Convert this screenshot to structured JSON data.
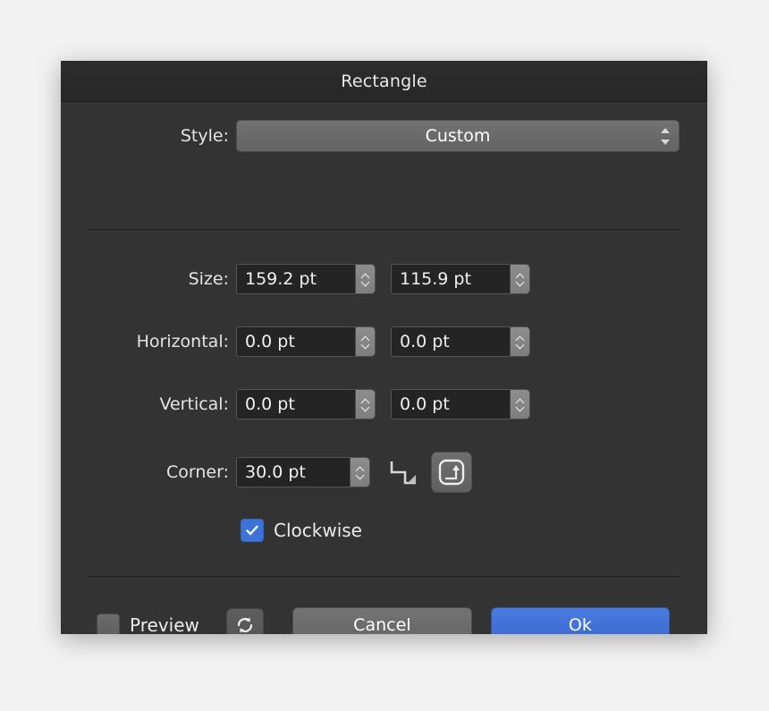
{
  "dialog": {
    "title": "Rectangle",
    "style_row": {
      "label": "Style:",
      "value": "Custom"
    },
    "rows": [
      {
        "label": "Size:",
        "value1": "159.2 pt",
        "value2": "115.9 pt"
      },
      {
        "label": "Horizontal:",
        "value1": "0.0 pt",
        "value2": "0.0 pt"
      },
      {
        "label": "Vertical:",
        "value1": "0.0 pt",
        "value2": "0.0 pt"
      }
    ],
    "corner_row": {
      "label": "Corner:",
      "value": "30.0 pt",
      "options": [
        {
          "name": "step-corner-icon",
          "selected": false
        },
        {
          "name": "rounded-corner-icon",
          "selected": true
        }
      ]
    },
    "clockwise": {
      "label": "Clockwise",
      "checked": true
    },
    "footer": {
      "preview_label": "Preview",
      "preview_checked": false,
      "refresh_icon": "refresh-icon",
      "cancel_label": "Cancel",
      "ok_label": "Ok"
    },
    "colors": {
      "accent": "#3d72d7",
      "dialog_bg": "#333333",
      "titlebar_bg": "#2a2a2a",
      "field_bg": "#242424",
      "text": "#ececec"
    }
  }
}
